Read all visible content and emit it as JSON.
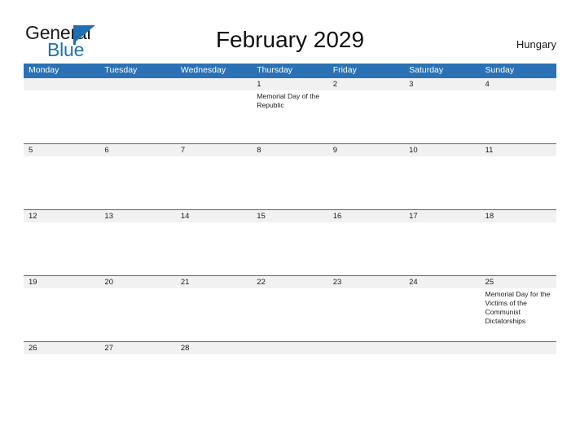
{
  "brand": {
    "name_part1": "General",
    "name_part2": "Blue",
    "flag_icon": "flag-triangle-icon",
    "colors": {
      "blue": "#1f6fb5",
      "dark": "#1a1a1a"
    }
  },
  "header": {
    "title": "February 2029",
    "region": "Hungary"
  },
  "theme": {
    "header_blue": "#2a72b5",
    "date_band_gray": "#f1f1f1",
    "row_rule_blue": "#2a72b5",
    "text_dark": "#1a1a1a",
    "page_background": "#ffffff"
  },
  "calendar": {
    "month": "February",
    "year": "2029",
    "weekday_headers": [
      "Monday",
      "Tuesday",
      "Wednesday",
      "Thursday",
      "Friday",
      "Saturday",
      "Sunday"
    ],
    "weeks": [
      {
        "days": [
          {
            "date": "",
            "event": ""
          },
          {
            "date": "",
            "event": ""
          },
          {
            "date": "",
            "event": ""
          },
          {
            "date": "1",
            "event": "Memorial Day of the Republic"
          },
          {
            "date": "2",
            "event": ""
          },
          {
            "date": "3",
            "event": ""
          },
          {
            "date": "4",
            "event": ""
          }
        ]
      },
      {
        "days": [
          {
            "date": "5",
            "event": ""
          },
          {
            "date": "6",
            "event": ""
          },
          {
            "date": "7",
            "event": ""
          },
          {
            "date": "8",
            "event": ""
          },
          {
            "date": "9",
            "event": ""
          },
          {
            "date": "10",
            "event": ""
          },
          {
            "date": "11",
            "event": ""
          }
        ]
      },
      {
        "days": [
          {
            "date": "12",
            "event": ""
          },
          {
            "date": "13",
            "event": ""
          },
          {
            "date": "14",
            "event": ""
          },
          {
            "date": "15",
            "event": ""
          },
          {
            "date": "16",
            "event": ""
          },
          {
            "date": "17",
            "event": ""
          },
          {
            "date": "18",
            "event": ""
          }
        ]
      },
      {
        "days": [
          {
            "date": "19",
            "event": ""
          },
          {
            "date": "20",
            "event": ""
          },
          {
            "date": "21",
            "event": ""
          },
          {
            "date": "22",
            "event": ""
          },
          {
            "date": "23",
            "event": ""
          },
          {
            "date": "24",
            "event": ""
          },
          {
            "date": "25",
            "event": "Memorial Day for the Victims of the Communist Dictatorships"
          }
        ]
      },
      {
        "days": [
          {
            "date": "26",
            "event": ""
          },
          {
            "date": "27",
            "event": ""
          },
          {
            "date": "28",
            "event": ""
          },
          {
            "date": "",
            "event": ""
          },
          {
            "date": "",
            "event": ""
          },
          {
            "date": "",
            "event": ""
          },
          {
            "date": "",
            "event": ""
          }
        ]
      }
    ]
  }
}
